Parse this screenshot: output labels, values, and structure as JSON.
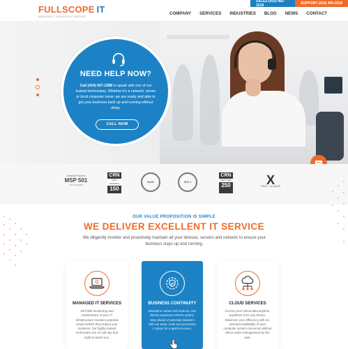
{
  "topbar": {
    "sales": "SALES (410) 465-3218",
    "support": "SUPPORT (410) 465-3218"
  },
  "logo": {
    "full": "FULLSCOPE",
    "it": "IT",
    "tagline": "MANAGED IT SERVICES & SUPPORT"
  },
  "nav": [
    "COMPANY",
    "SERVICES",
    "INDUSTRIES",
    "BLOG",
    "NEWS",
    "CONTACT"
  ],
  "hero": {
    "title": "NEED HELP NOW?",
    "body_phone": "Call (410) 927-1388",
    "body_rest": " to speak with one of our trained technicians. Whether it's a network, server or local computer issue, we are ready and able to get your business back up and running without delay.",
    "cta": "CALL NOW"
  },
  "logos": {
    "msp_small": "Channel Futures",
    "msp_big": "MSP 501",
    "msp_tiny": "2021 WINNER",
    "crn1_top": "CRN",
    "crn1_sub": "FAST GROWTH",
    "crn1_num": "150",
    "round1": "BLUE",
    "round2": "SOC 2",
    "crn2_top": "CRN",
    "crn2_sub": "NEXT-GEN",
    "crn2_num": "250",
    "trust_x": "X",
    "trust_words": "TRUST · ALLIANCE"
  },
  "value_prop": {
    "kicker": "OUR VALUE PROPOSITION IS SIMPLE",
    "title": "WE DELIVER EXCELLENT IT SERVICE",
    "text": "We diligently monitor and proactively maintain all your devices, servers and network to ensure your business stays up and running."
  },
  "services": [
    {
      "title": "MANAGED IT SERVICES",
      "text": "24/7/365 monitoring and maintenance of your IT infrastructure resolves potential issues before they impact your business. Our highly-trained technicians are on call day and night to assist you."
    },
    {
      "title": "BUSINESS CONTINUITY",
      "text": "Downtime means lost revenue. Our clients experience 99.9% uptime. Stay ahead of potential disasters with our team, tools and processes in place for a quick recovery."
    },
    {
      "title": "CLOUD SERVICES",
      "text": "Access your critical data anytime, anywhere from any device. Maximize your efficiency with on-demand availability of your computer system resources without direct active management by the user."
    }
  ],
  "colors": {
    "brand_blue": "#1d82c5",
    "brand_orange": "#ee6b2b"
  },
  "icons": {
    "hero": "headset-icon",
    "managed": "laptop-icon",
    "business": "shield-gear-icon",
    "cloud": "cloud-network-icon",
    "chat": "chat-icon"
  }
}
